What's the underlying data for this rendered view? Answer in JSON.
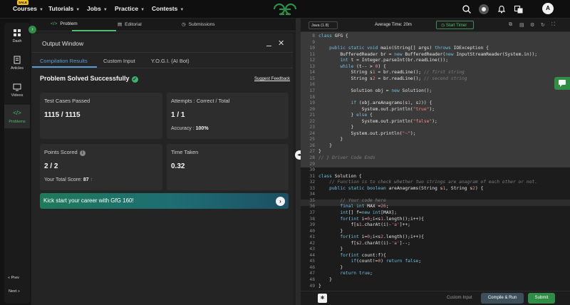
{
  "nav": {
    "sale_badge": "SALE",
    "courses": "Courses",
    "tutorials": "Tutorials",
    "jobs": "Jobs",
    "practice": "Practice",
    "contests": "Contests",
    "avatar_letter": "A"
  },
  "sidebar": {
    "dash": "Dash",
    "articles": "Articles",
    "videos": "Videos",
    "problems": "Problems",
    "prev": "« Prev",
    "next": "Next »"
  },
  "tabs": {
    "problem": "Problem",
    "editorial": "Editorial",
    "submissions": "Submissions"
  },
  "output": {
    "title": "Output Window",
    "tabs": [
      "Compilation Results",
      "Custom Input",
      "Y.O.G.I. (AI Bot)"
    ],
    "status": "Problem Solved Successfully",
    "suggest_feedback": "Suggest Feedback",
    "test_cases_label": "Test Cases Passed",
    "test_cases_value": "1115 / 1115",
    "attempts_label": "Attempts : Correct / Total",
    "attempts_value": "1 / 1",
    "accuracy_label": "Accuracy :",
    "accuracy_value": "100%",
    "points_label": "Points Scored",
    "points_value": "2 / 2",
    "total_score_label": "Your Total Score:",
    "total_score_value": "87",
    "time_label": "Time Taken",
    "time_value": "0.32",
    "banner": "Kick start your career with GfG 160!"
  },
  "editor": {
    "language": "Java (1.8)",
    "avg_time": "Average Time: 20m",
    "start_timer": "Start Timer",
    "custom_input": "Custom Input",
    "compile_run": "Compile & Run",
    "submit": "Submit"
  },
  "code_lines": [
    {
      "n": "8",
      "t": "class GFG {"
    },
    {
      "n": "9",
      "t": ""
    },
    {
      "n": "10",
      "t": "    public static void main(String[] args) throws IOException {"
    },
    {
      "n": "11",
      "t": "        BufferedReader br = new BufferedReader(new InputStreamReader(System.in));"
    },
    {
      "n": "12",
      "t": "        int t = Integer.parseInt(br.readLine());"
    },
    {
      "n": "13",
      "t": "        while (t-- > 0) {"
    },
    {
      "n": "14",
      "t": "            String s1 = br.readLine(); // first string"
    },
    {
      "n": "15",
      "t": "            String s2 = br.readLine(); // second string"
    },
    {
      "n": "16",
      "t": ""
    },
    {
      "n": "17",
      "t": "            Solution obj = new Solution();"
    },
    {
      "n": "18",
      "t": ""
    },
    {
      "n": "19",
      "t": "            if (obj.areAnagrams(s1, s2)) {"
    },
    {
      "n": "20",
      "t": "                System.out.println(\"true\");"
    },
    {
      "n": "21",
      "t": "            } else {"
    },
    {
      "n": "22",
      "t": "                System.out.println(\"false\");"
    },
    {
      "n": "23",
      "t": "            }"
    },
    {
      "n": "24",
      "t": "            System.out.println(\"~\");"
    },
    {
      "n": "25",
      "t": "        }"
    },
    {
      "n": "26",
      "t": "    }"
    },
    {
      "n": "27",
      "t": "}"
    },
    {
      "n": "28",
      "t": "// } Driver Code Ends"
    },
    {
      "n": "29",
      "t": ""
    },
    {
      "n": "30",
      "t": ""
    },
    {
      "n": "31",
      "t": "class Solution {"
    },
    {
      "n": "32",
      "t": "    // Function is to check whether two strings are anagram of each other or not."
    },
    {
      "n": "33",
      "t": "    public static boolean areAnagrams(String s1, String s2) {"
    },
    {
      "n": "34",
      "t": ""
    },
    {
      "n": "35",
      "t": "        // Your code here"
    },
    {
      "n": "36",
      "t": "        final int MAX =26;"
    },
    {
      "n": "37",
      "t": "        int[] f=new int[MAX];"
    },
    {
      "n": "38",
      "t": "        for(int i=0;i<s1.length();i++){"
    },
    {
      "n": "39",
      "t": "            f[s1.charAt(i)-'a']++;"
    },
    {
      "n": "40",
      "t": "        }"
    },
    {
      "n": "41",
      "t": "        for(int i=0;i<s2.length();i++){"
    },
    {
      "n": "42",
      "t": "            f[s2.charAt(i)-'a']--;"
    },
    {
      "n": "43",
      "t": "        }"
    },
    {
      "n": "44",
      "t": "        for(int count:f){"
    },
    {
      "n": "45",
      "t": "            if(count!=0) return false;"
    },
    {
      "n": "46",
      "t": "        }"
    },
    {
      "n": "47",
      "t": "        return true;"
    },
    {
      "n": "48",
      "t": "    }"
    },
    {
      "n": "49",
      "t": "}"
    }
  ],
  "colors": {
    "accent_green": "#2f8d46",
    "link_blue": "#5b9bd5"
  }
}
